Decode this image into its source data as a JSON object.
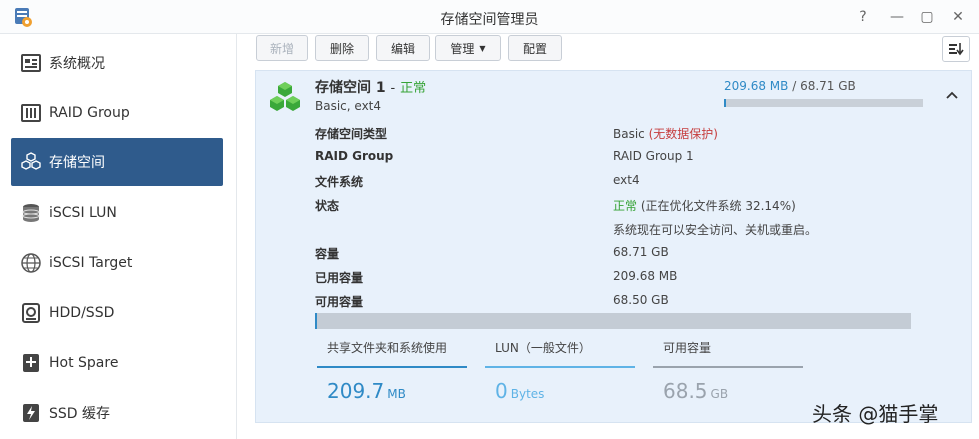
{
  "window": {
    "title": "存储空间管理员",
    "controls": {
      "help": "?",
      "minimize": "—",
      "maximize": "▢",
      "close": "✕"
    }
  },
  "sidebar": {
    "items": [
      {
        "label": "系统概况",
        "icon": "overview-icon",
        "active": false
      },
      {
        "label": "RAID Group",
        "icon": "raid-icon",
        "active": false
      },
      {
        "label": "存储空间",
        "icon": "storage-cubes-icon",
        "active": true
      },
      {
        "label": "iSCSI LUN",
        "icon": "iscsi-lun-icon",
        "active": false
      },
      {
        "label": "iSCSI Target",
        "icon": "iscsi-target-icon",
        "active": false
      },
      {
        "label": "HDD/SSD",
        "icon": "disk-icon",
        "active": false
      },
      {
        "label": "Hot Spare",
        "icon": "hot-spare-icon",
        "active": false
      },
      {
        "label": "SSD 缓存",
        "icon": "ssd-cache-icon",
        "active": false
      }
    ]
  },
  "toolbar": {
    "new_label": "新增",
    "delete_label": "删除",
    "edit_label": "编辑",
    "manage_label": "管理",
    "config_label": "配置"
  },
  "volume": {
    "name": "存储空间 1",
    "separator": "-",
    "status": "正常",
    "subtitle": "Basic, ext4",
    "used": "209.68 MB",
    "slash": " / ",
    "total": "68.71 GB",
    "usage_fraction": 0.003,
    "details": {
      "type_label": "存储空间类型",
      "type_value": "Basic",
      "type_note": "(无数据保护)",
      "raid_label": "RAID Group",
      "raid_value": "RAID Group 1",
      "fs_label": "文件系统",
      "fs_value": "ext4",
      "status_label": "状态",
      "status_value": "正常",
      "status_note": "(正在优化文件系统 32.14%)",
      "status_line2": "系统现在可以安全访问、关机或重启。",
      "capacity_label": "容量",
      "capacity_value": "68.71 GB",
      "used_label": "已用容量",
      "used_value": "209.68 MB",
      "avail_label": "可用容量",
      "avail_value": "68.50 GB"
    },
    "legend": [
      {
        "label": "共享文件夹和系统使用",
        "value": "209.7",
        "unit": "MB",
        "color": "#2f8ac6"
      },
      {
        "label": "LUN（一般文件）",
        "value": "0",
        "unit": "Bytes",
        "color": "#5fb3e6"
      },
      {
        "label": "可用容量",
        "value": "68.5",
        "unit": "GB",
        "color": "#9aa3ad"
      }
    ]
  },
  "watermark": "头条 @猫手掌"
}
